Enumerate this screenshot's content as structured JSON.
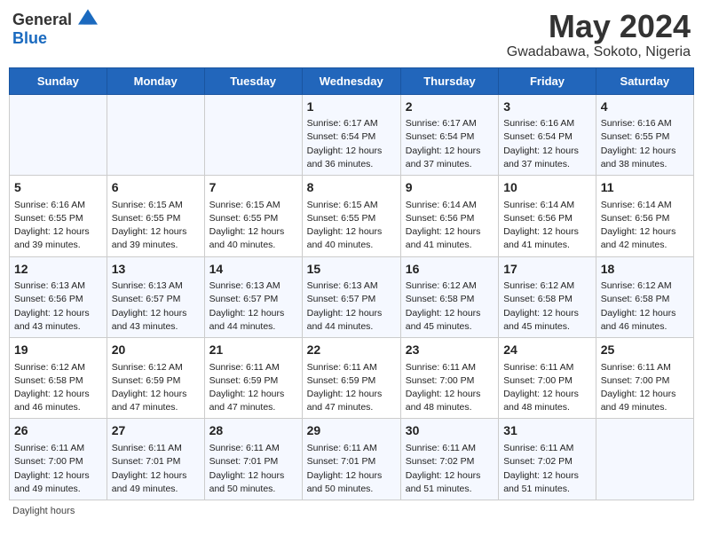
{
  "header": {
    "logo_general": "General",
    "logo_blue": "Blue",
    "title": "May 2024",
    "subtitle": "Gwadabawa, Sokoto, Nigeria"
  },
  "columns": [
    "Sunday",
    "Monday",
    "Tuesday",
    "Wednesday",
    "Thursday",
    "Friday",
    "Saturday"
  ],
  "weeks": [
    [
      {
        "day": "",
        "info": ""
      },
      {
        "day": "",
        "info": ""
      },
      {
        "day": "",
        "info": ""
      },
      {
        "day": "1",
        "info": "Sunrise: 6:17 AM\nSunset: 6:54 PM\nDaylight: 12 hours and 36 minutes."
      },
      {
        "day": "2",
        "info": "Sunrise: 6:17 AM\nSunset: 6:54 PM\nDaylight: 12 hours and 37 minutes."
      },
      {
        "day": "3",
        "info": "Sunrise: 6:16 AM\nSunset: 6:54 PM\nDaylight: 12 hours and 37 minutes."
      },
      {
        "day": "4",
        "info": "Sunrise: 6:16 AM\nSunset: 6:55 PM\nDaylight: 12 hours and 38 minutes."
      }
    ],
    [
      {
        "day": "5",
        "info": "Sunrise: 6:16 AM\nSunset: 6:55 PM\nDaylight: 12 hours and 39 minutes."
      },
      {
        "day": "6",
        "info": "Sunrise: 6:15 AM\nSunset: 6:55 PM\nDaylight: 12 hours and 39 minutes."
      },
      {
        "day": "7",
        "info": "Sunrise: 6:15 AM\nSunset: 6:55 PM\nDaylight: 12 hours and 40 minutes."
      },
      {
        "day": "8",
        "info": "Sunrise: 6:15 AM\nSunset: 6:55 PM\nDaylight: 12 hours and 40 minutes."
      },
      {
        "day": "9",
        "info": "Sunrise: 6:14 AM\nSunset: 6:56 PM\nDaylight: 12 hours and 41 minutes."
      },
      {
        "day": "10",
        "info": "Sunrise: 6:14 AM\nSunset: 6:56 PM\nDaylight: 12 hours and 41 minutes."
      },
      {
        "day": "11",
        "info": "Sunrise: 6:14 AM\nSunset: 6:56 PM\nDaylight: 12 hours and 42 minutes."
      }
    ],
    [
      {
        "day": "12",
        "info": "Sunrise: 6:13 AM\nSunset: 6:56 PM\nDaylight: 12 hours and 43 minutes."
      },
      {
        "day": "13",
        "info": "Sunrise: 6:13 AM\nSunset: 6:57 PM\nDaylight: 12 hours and 43 minutes."
      },
      {
        "day": "14",
        "info": "Sunrise: 6:13 AM\nSunset: 6:57 PM\nDaylight: 12 hours and 44 minutes."
      },
      {
        "day": "15",
        "info": "Sunrise: 6:13 AM\nSunset: 6:57 PM\nDaylight: 12 hours and 44 minutes."
      },
      {
        "day": "16",
        "info": "Sunrise: 6:12 AM\nSunset: 6:58 PM\nDaylight: 12 hours and 45 minutes."
      },
      {
        "day": "17",
        "info": "Sunrise: 6:12 AM\nSunset: 6:58 PM\nDaylight: 12 hours and 45 minutes."
      },
      {
        "day": "18",
        "info": "Sunrise: 6:12 AM\nSunset: 6:58 PM\nDaylight: 12 hours and 46 minutes."
      }
    ],
    [
      {
        "day": "19",
        "info": "Sunrise: 6:12 AM\nSunset: 6:58 PM\nDaylight: 12 hours and 46 minutes."
      },
      {
        "day": "20",
        "info": "Sunrise: 6:12 AM\nSunset: 6:59 PM\nDaylight: 12 hours and 47 minutes."
      },
      {
        "day": "21",
        "info": "Sunrise: 6:11 AM\nSunset: 6:59 PM\nDaylight: 12 hours and 47 minutes."
      },
      {
        "day": "22",
        "info": "Sunrise: 6:11 AM\nSunset: 6:59 PM\nDaylight: 12 hours and 47 minutes."
      },
      {
        "day": "23",
        "info": "Sunrise: 6:11 AM\nSunset: 7:00 PM\nDaylight: 12 hours and 48 minutes."
      },
      {
        "day": "24",
        "info": "Sunrise: 6:11 AM\nSunset: 7:00 PM\nDaylight: 12 hours and 48 minutes."
      },
      {
        "day": "25",
        "info": "Sunrise: 6:11 AM\nSunset: 7:00 PM\nDaylight: 12 hours and 49 minutes."
      }
    ],
    [
      {
        "day": "26",
        "info": "Sunrise: 6:11 AM\nSunset: 7:00 PM\nDaylight: 12 hours and 49 minutes."
      },
      {
        "day": "27",
        "info": "Sunrise: 6:11 AM\nSunset: 7:01 PM\nDaylight: 12 hours and 49 minutes."
      },
      {
        "day": "28",
        "info": "Sunrise: 6:11 AM\nSunset: 7:01 PM\nDaylight: 12 hours and 50 minutes."
      },
      {
        "day": "29",
        "info": "Sunrise: 6:11 AM\nSunset: 7:01 PM\nDaylight: 12 hours and 50 minutes."
      },
      {
        "day": "30",
        "info": "Sunrise: 6:11 AM\nSunset: 7:02 PM\nDaylight: 12 hours and 51 minutes."
      },
      {
        "day": "31",
        "info": "Sunrise: 6:11 AM\nSunset: 7:02 PM\nDaylight: 12 hours and 51 minutes."
      },
      {
        "day": "",
        "info": ""
      }
    ]
  ],
  "footer": {
    "daylight_label": "Daylight hours"
  }
}
